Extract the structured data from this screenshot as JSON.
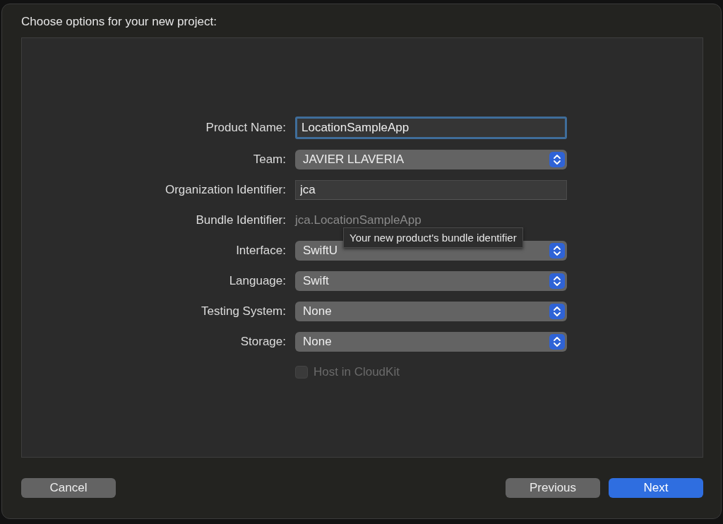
{
  "window": {
    "title": "Choose options for your new project:"
  },
  "fields": [
    {
      "kind": "text",
      "label": "Product Name:",
      "value": "LocationSampleApp",
      "focused": true
    },
    {
      "kind": "popup",
      "label": "Team:",
      "value": "JAVIER LLAVERIA"
    },
    {
      "kind": "text",
      "label": "Organization Identifier:",
      "value": "jca",
      "focused": false
    },
    {
      "kind": "static",
      "label": "Bundle Identifier:",
      "value": "jca.LocationSampleApp"
    },
    {
      "kind": "popup",
      "label": "Interface:",
      "value": "SwiftU"
    },
    {
      "kind": "popup",
      "label": "Language:",
      "value": "Swift"
    },
    {
      "kind": "popup",
      "label": "Testing System:",
      "value": "None"
    },
    {
      "kind": "popup",
      "label": "Storage:",
      "value": "None"
    },
    {
      "kind": "checkbox",
      "label": "Host in CloudKit",
      "checked": false,
      "disabled": true
    }
  ],
  "tooltip": {
    "text": "Your new product's bundle identifier"
  },
  "left_buttons": [
    {
      "label": "Cancel",
      "default": false
    }
  ],
  "right_buttons": [
    {
      "label": "Previous",
      "default": false
    },
    {
      "label": "Next",
      "default": true
    }
  ]
}
